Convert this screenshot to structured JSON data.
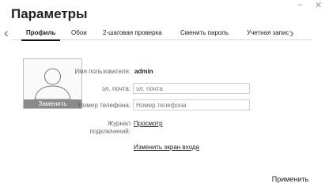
{
  "window": {
    "title": "Параметры",
    "minimize_label": "–",
    "close_label": "✕"
  },
  "tabs": [
    {
      "label": "Профиль",
      "active": true
    },
    {
      "label": "Обои",
      "active": false
    },
    {
      "label": "2-шаговая проверка",
      "active": false
    },
    {
      "label": "Сменить пароль",
      "active": false
    },
    {
      "label": "Учетная запис",
      "active": false
    }
  ],
  "nav": {
    "prev_icon": "‹",
    "next_icon": "›"
  },
  "profile": {
    "change_photo_label": "Заменить",
    "username_label": "Имя пользователя:",
    "username_value": "admin",
    "email_label": "эл. почта:",
    "email_placeholder": "эл. почта",
    "phone_label": "Номер телефона:",
    "phone_placeholder": "Номер телефона",
    "log_label_line1": "Журнал",
    "log_label_line2": "подключений:",
    "log_link": "Просмотр",
    "login_screen_link": "Изменить экран входа"
  },
  "footer": {
    "apply_label": "Применить"
  }
}
